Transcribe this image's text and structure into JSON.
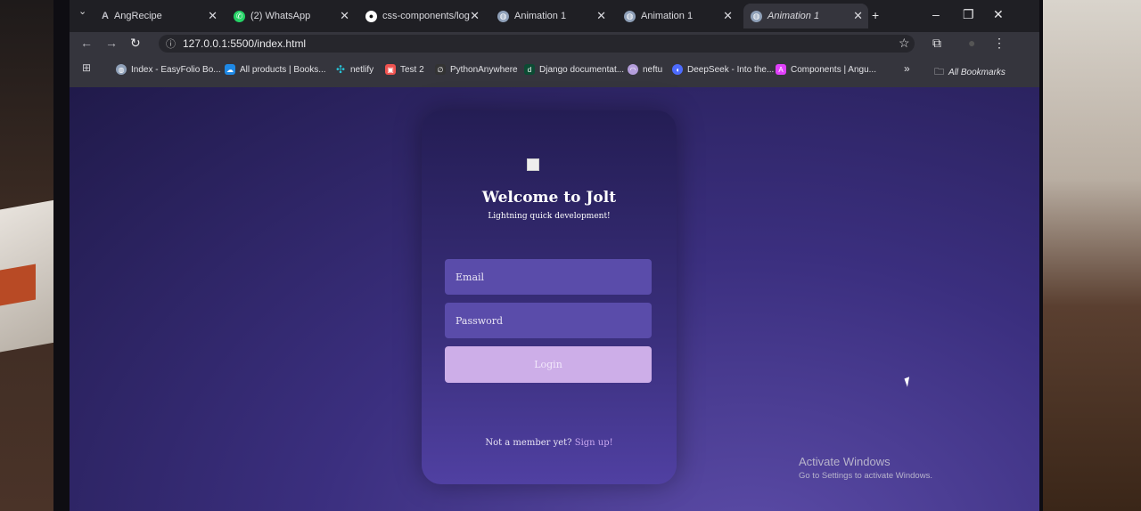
{
  "browser": {
    "tabs": [
      {
        "title": "AngRecipe",
        "icon": "angular-icon",
        "color": "#c0c0c8"
      },
      {
        "title": "(2) WhatsApp",
        "icon": "whatsapp-icon",
        "color": "#25d366"
      },
      {
        "title": "css-components/log",
        "icon": "github-icon",
        "color": "#ffffff"
      },
      {
        "title": "Animation 1",
        "icon": "globe-icon",
        "color": "#8fa0b8"
      },
      {
        "title": "Animation 1",
        "icon": "globe-icon",
        "color": "#8fa0b8"
      },
      {
        "title": "Animation 1",
        "icon": "globe-icon",
        "color": "#8fa0b8",
        "active": true
      }
    ],
    "url": "127.0.0.1:5500/index.html",
    "bookmarks": [
      {
        "label": "Index - EasyFolio Bo...",
        "icon": "globe-icon",
        "color": "#8fa0b8"
      },
      {
        "label": "All products | Books...",
        "icon": "cloud-icon",
        "color": "#1e88e5"
      },
      {
        "label": "netlify",
        "icon": "netlify-icon",
        "color": "#26c6da"
      },
      {
        "label": "Test 2",
        "icon": "test-icon",
        "color": "#ef5350"
      },
      {
        "label": "PythonAnywhere",
        "icon": "python-icon",
        "color": "#333333"
      },
      {
        "label": "Django documentat...",
        "icon": "django-icon",
        "color": "#0c4b33"
      },
      {
        "label": "neftu",
        "icon": "ghost-icon",
        "color": "#b39ddb"
      },
      {
        "label": "DeepSeek - Into the...",
        "icon": "deepseek-icon",
        "color": "#4d6bfe"
      },
      {
        "label": "Components | Angu...",
        "icon": "angular-icon",
        "color": "#e040fb"
      }
    ],
    "all_bookmarks": "All Bookmarks"
  },
  "page": {
    "title": "Welcome to Jolt",
    "subtitle": "Lightning quick development!",
    "email_placeholder": "Email",
    "password_placeholder": "Password",
    "login_label": "Login",
    "footer_text": "Not a member yet?",
    "signup_link": "Sign up!"
  },
  "os": {
    "activate_title": "Activate Windows",
    "activate_sub": "Go to Settings to activate Windows."
  }
}
